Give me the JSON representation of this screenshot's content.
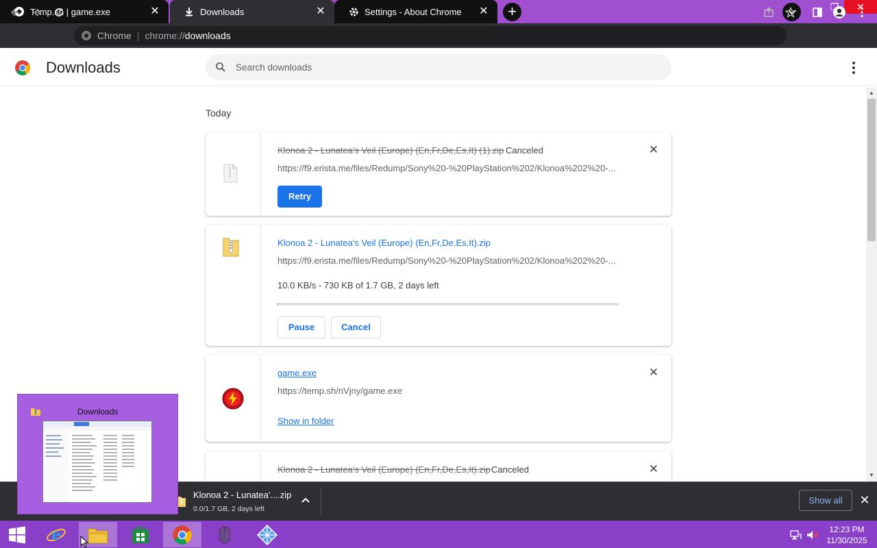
{
  "tabs": [
    {
      "label": "Temp.sh | game.exe",
      "icon": "temp-sh-icon"
    },
    {
      "label": "Downloads",
      "icon": "download-icon"
    },
    {
      "label": "Settings - About Chrome",
      "icon": "gear-icon"
    }
  ],
  "omnibox": {
    "site_label": "Chrome",
    "url_host": "chrome://",
    "url_path": "downloads"
  },
  "page": {
    "title": "Downloads"
  },
  "search": {
    "placeholder": "Search downloads"
  },
  "section_today": "Today",
  "downloads": [
    {
      "filename": "Klonoa 2 - Lunatea's Veil (Europe) (En,Fr,De,Es,It) (1).zip",
      "status": "Canceled",
      "url": "https://f9.erista.me/files/Redump/Sony%20-%20PlayStation%202/Klonoa%202%20-...",
      "action": "Retry"
    },
    {
      "filename": "Klonoa 2 - Lunatea's Veil (Europe) (En,Fr,De,Es,It).zip",
      "url": "https://f9.erista.me/files/Redump/Sony%20-%20PlayStation%202/Klonoa%202%20-...",
      "progress_text": "10.0 KB/s - 730 KB of 1.7 GB, 2 days left",
      "progress_fraction": 0.0004,
      "pause_label": "Pause",
      "cancel_label": "Cancel"
    },
    {
      "filename": "game.exe",
      "url": "https://temp.sh/nVjny/game.exe",
      "action": "Show in folder"
    },
    {
      "filename": "Klonoa 2 - Lunatea's Veil (Europe) (En,Fr,De,Es,It).zip",
      "status": "Canceled"
    }
  ],
  "shelf": {
    "item_name": "Klonoa 2 - Lunatea'....zip",
    "item_status": "0.0/1.7 GB, 2 days left",
    "show_all": "Show all"
  },
  "thumbnail": {
    "title": "Downloads"
  },
  "clock": {
    "time": "12:23 PM",
    "date": "11/30/2025"
  },
  "colors": {
    "accent": "#1a73e8",
    "titlebar": "#a04fd0",
    "taskbar": "#8a3fc9"
  }
}
